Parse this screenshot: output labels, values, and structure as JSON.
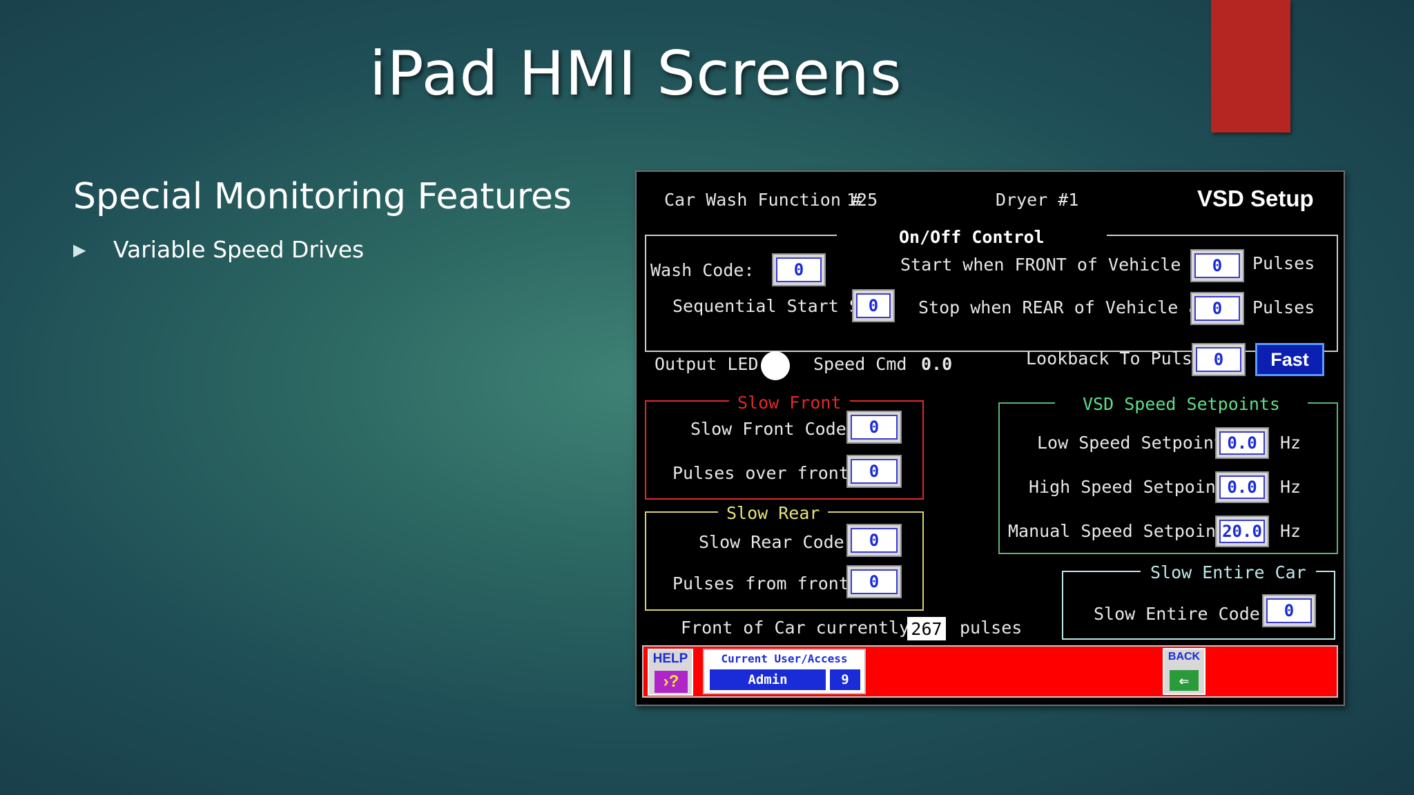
{
  "slide": {
    "title": "iPad HMI Screens",
    "subtitle": "Special Monitoring Features",
    "bullets": [
      {
        "label": "Variable Speed Drives"
      }
    ]
  },
  "hmi": {
    "header": {
      "function_label": "Car Wash Function #",
      "function_number": "125",
      "dryer": "Dryer #1",
      "screen_title": "VSD Setup"
    },
    "onoff": {
      "title": "On/Off Control",
      "wash_code_label": "Wash Code:",
      "wash_code": "0",
      "seq_start_label": "Sequential Start Sp",
      "seq_start": "0",
      "start_front_label": "Start when FRONT of Vehicle at",
      "start_front": "0",
      "start_front_unit": "Pulses",
      "stop_rear_label": "Stop when REAR of Vehicle at",
      "stop_rear": "0",
      "stop_rear_unit": "Pulses",
      "output_led_label": "Output LED",
      "speed_cmd_label": "Speed Cmd",
      "speed_cmd": "0.0",
      "lookback_label": "Lookback To Pulse",
      "lookback": "0",
      "fast_label": "Fast"
    },
    "slow_front": {
      "title": "Slow Front",
      "code_label": "Slow Front Code",
      "code": "0",
      "pulses_label": "Pulses over front",
      "pulses": "0"
    },
    "slow_rear": {
      "title": "Slow Rear",
      "code_label": "Slow Rear Code",
      "code": "0",
      "pulses_label": "Pulses from front",
      "pulses": "0"
    },
    "vsd": {
      "title": "VSD Speed Setpoints",
      "low_label": "Low Speed Setpoint",
      "low": "0.0",
      "high_label": "High Speed Setpoint",
      "high": "0.0",
      "manual_label": "Manual Speed Setpoint",
      "manual": "20.0",
      "unit": "Hz"
    },
    "slow_entire": {
      "title": "Slow Entire Car",
      "code_label": "Slow Entire Code",
      "code": "0"
    },
    "position": {
      "label": "Front of Car currently @",
      "value": "267",
      "unit": "pulses"
    },
    "footer": {
      "help_label": "HELP",
      "help_icon_glyph": "›?",
      "user_label": "Current User/Access",
      "user_name": "Admin",
      "user_level": "9",
      "back_label": "BACK",
      "back_icon_glyph": "⇐"
    }
  },
  "colors": {
    "red_accent": "#b52522",
    "field_text": "#1a2bd8",
    "slow_front": "#e02a2a",
    "slow_rear": "#d9d46a",
    "vsd": "#58b878",
    "slow_entire": "#bfe8ea",
    "footer_bar": "#ff0000"
  }
}
